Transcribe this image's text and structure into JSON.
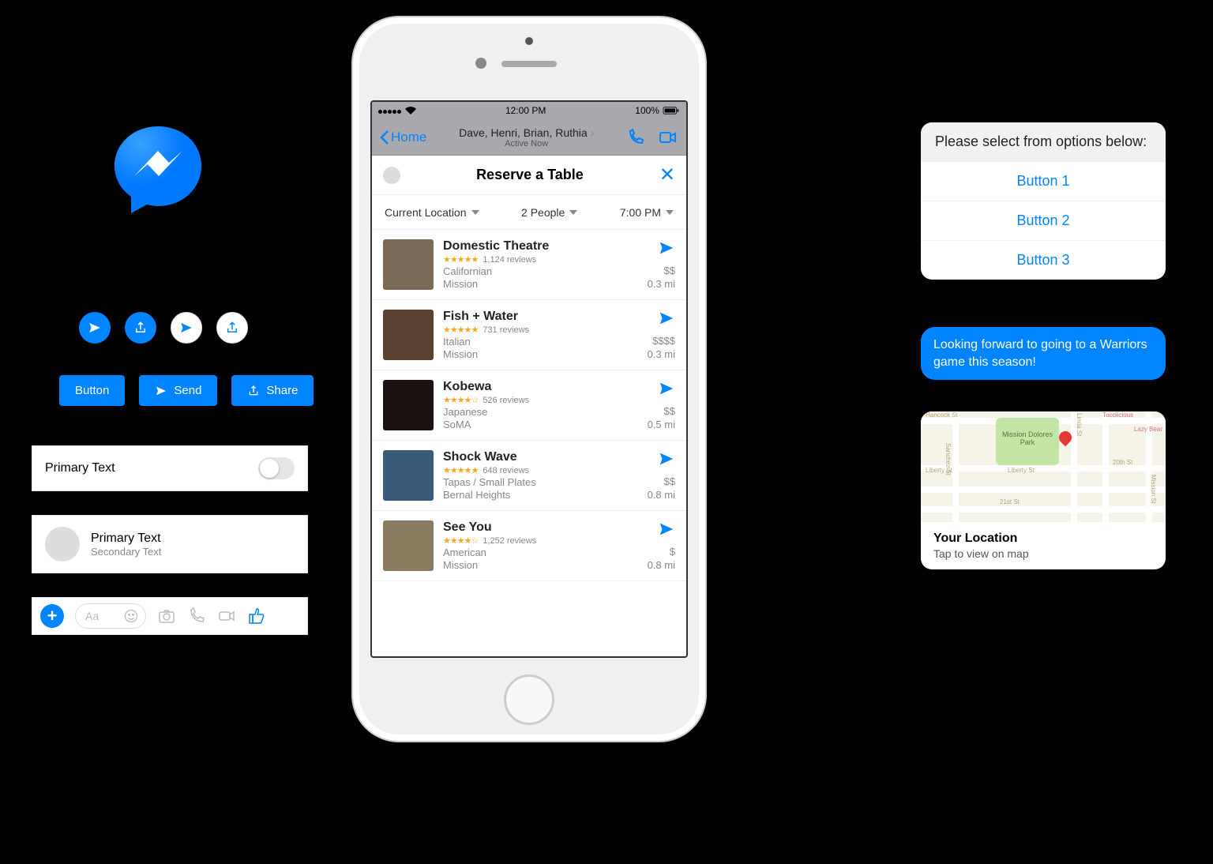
{
  "colors": {
    "accent": "#0084FF"
  },
  "left": {
    "buttons": {
      "generic": "Button",
      "send": "Send",
      "share": "Share"
    },
    "cell1": {
      "primary": "Primary Text"
    },
    "cell2": {
      "primary": "Primary Text",
      "secondary": "Secondary Text"
    },
    "composer_placeholder": "Aa"
  },
  "phone": {
    "status": {
      "time": "12:00 PM",
      "battery": "100%"
    },
    "nav": {
      "back": "Home",
      "title": "Dave, Henri, Brian, Ruthia",
      "subtitle": "Active Now"
    },
    "sheet_title": "Reserve a Table",
    "filters": {
      "location": "Current Location",
      "people": "2 People",
      "time": "7:00 PM"
    },
    "results": [
      {
        "name": "Domestic Theatre",
        "stars": "★★★★★",
        "reviews": "1,124 reviews",
        "cuisine": "Californian",
        "hood": "Mission",
        "price": "$$",
        "dist": "0.3 mi"
      },
      {
        "name": "Fish + Water",
        "stars": "★★★★★",
        "reviews": "731 reviews",
        "cuisine": "Italian",
        "hood": "Mission",
        "price": "$$$$",
        "dist": "0.3 mi"
      },
      {
        "name": "Kobewa",
        "stars": "★★★★☆",
        "reviews": "526 reviews",
        "cuisine": "Japanese",
        "hood": "SoMA",
        "price": "$$",
        "dist": "0.5 mi"
      },
      {
        "name": "Shock Wave",
        "stars": "★★★★★",
        "reviews": "648 reviews",
        "cuisine": "Tapas / Small Plates",
        "hood": "Bernal Heights",
        "price": "$$",
        "dist": "0.8 mi"
      },
      {
        "name": "See You",
        "stars": "★★★★☆",
        "reviews": "1,252 reviews",
        "cuisine": "American",
        "hood": "Mission",
        "price": "$",
        "dist": "0.8 mi"
      }
    ]
  },
  "right": {
    "options": {
      "header": "Please select from options below:",
      "buttons": [
        "Button 1",
        "Button 2",
        "Button 3"
      ]
    },
    "bubble": "Looking forward to going to a Warriors game this season!",
    "map": {
      "title": "Your Location",
      "subtitle": "Tap to view on map",
      "park": "Mission Dolores Park",
      "streets": {
        "hancock": "Hancock St",
        "liberty": "Liberty St",
        "twentieth": "20th St",
        "twentyfirst": "21st St",
        "linda": "Linda St",
        "mission": "Mission St",
        "tacolicious": "Tacolicious",
        "lazybear": "Lazy Bear",
        "sanchez": "Sanchez St"
      }
    }
  }
}
